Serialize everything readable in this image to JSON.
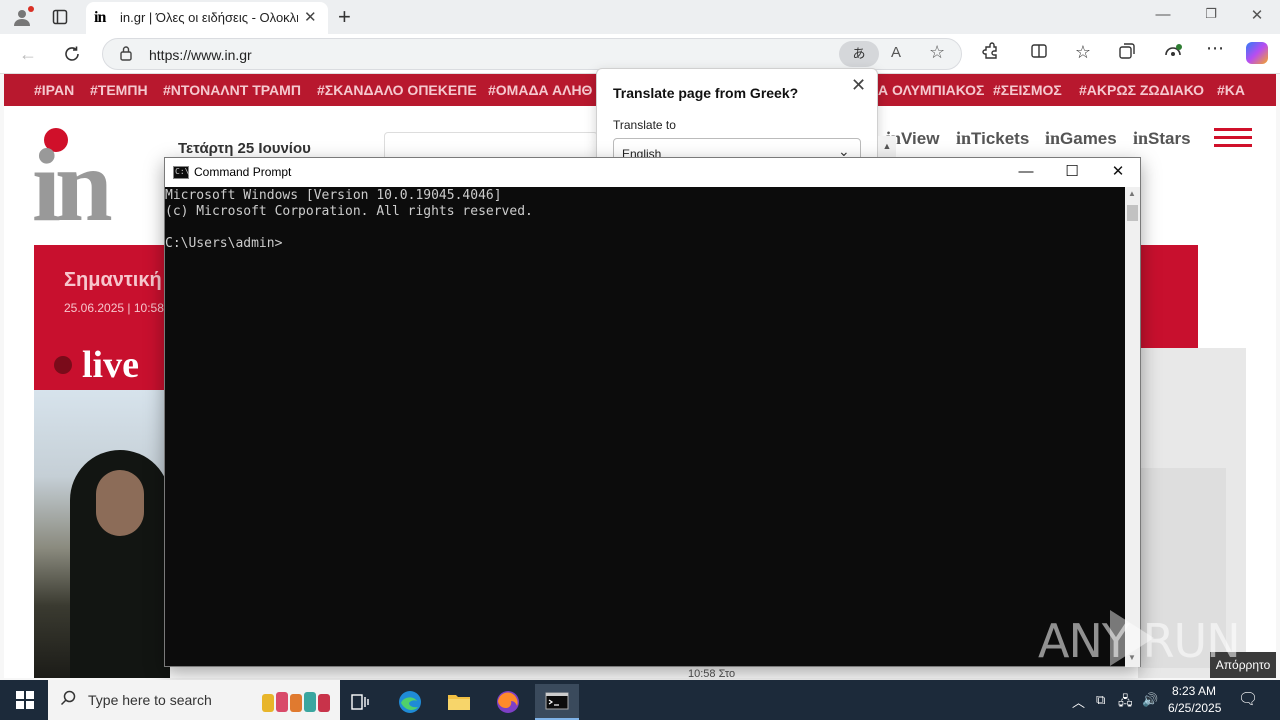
{
  "browser": {
    "tab_title": "in.gr | Όλες οι ειδήσεις - Ολοκληρωμένη",
    "tab_favicon": "in",
    "url": "https://www.in.gr",
    "translate_icon": "あ",
    "readaloud_icon": "A",
    "new_tab": "+"
  },
  "site": {
    "hashtags": [
      "#ΙΡΑΝ",
      "#ΤΕΜΠΗ",
      "#ΝΤΟΝΑΛΝΤ ΤΡΑΜΠ",
      "#ΣΚΑΝΔΑΛΟ ΟΠΕΚΕΠΕ",
      "#ΟΜΑΔΑ ΑΛΗΘ",
      "Α ΟΛΥΜΠΙΑΚΟΣ",
      "#ΣΕΙΣΜΟΣ",
      "#ΑΚΡΩΣ ΖΩΔΙΑΚΟ",
      "#ΚΑ"
    ],
    "logo": "in",
    "date": "Τετάρτη 25 Ιουνίου",
    "nav": [
      {
        "prefix": "in",
        "label": "View"
      },
      {
        "prefix": "in",
        "label": "Tickets"
      },
      {
        "prefix": "in",
        "label": "Games"
      },
      {
        "prefix": "in",
        "label": "Stars"
      }
    ],
    "breaking_headline": "Σημαντική",
    "breaking_date": "25.06.2025 | 10:58",
    "live_label": "live",
    "unpublished": "Απόρρητο",
    "tiny_text": "10:58 Στο"
  },
  "translate_popup": {
    "title": "Translate page from Greek?",
    "label": "Translate to",
    "selected": "English"
  },
  "cmd": {
    "title": "Command Prompt",
    "lines": [
      "Microsoft Windows [Version 10.0.19045.4046]",
      "(c) Microsoft Corporation. All rights reserved.",
      "",
      "C:\\Users\\admin>"
    ]
  },
  "watermark": "ANY RUN",
  "taskbar": {
    "search_placeholder": "Type here to search",
    "time": "8:23 AM",
    "date": "6/25/2025"
  }
}
